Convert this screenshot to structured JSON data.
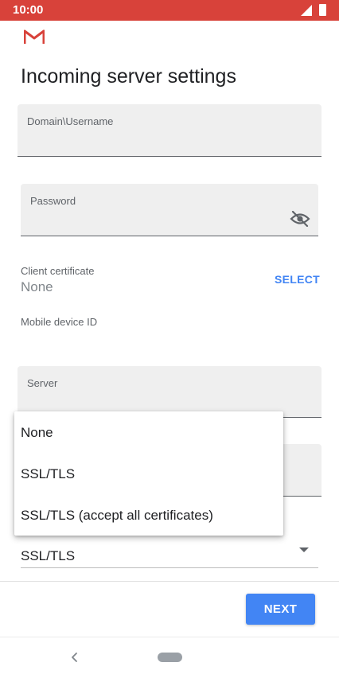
{
  "status_bar": {
    "time": "10:00"
  },
  "page": {
    "title": "Incoming server settings"
  },
  "fields": {
    "username": {
      "label": "Domain\\Username",
      "value": ""
    },
    "password": {
      "label": "Password",
      "value": ""
    },
    "server": {
      "label": "Server",
      "value": ""
    }
  },
  "client_certificate": {
    "label": "Client certificate",
    "value": "None",
    "action": "SELECT"
  },
  "mobile_device_id": {
    "label": "Mobile device ID"
  },
  "security": {
    "selected": "SSL/TLS"
  },
  "dropdown": {
    "options": [
      "None",
      "SSL/TLS",
      "SSL/TLS (accept all certificates)"
    ]
  },
  "footer": {
    "next_label": "NEXT"
  },
  "colors": {
    "status_bar": "#d8423a",
    "accent": "#4285f4",
    "field_bg": "#efefef"
  },
  "icons": [
    "gmail-logo-icon",
    "signal-icon",
    "battery-icon",
    "visibility-off-icon",
    "dropdown-arrow-icon",
    "back-icon",
    "home-icon"
  ]
}
